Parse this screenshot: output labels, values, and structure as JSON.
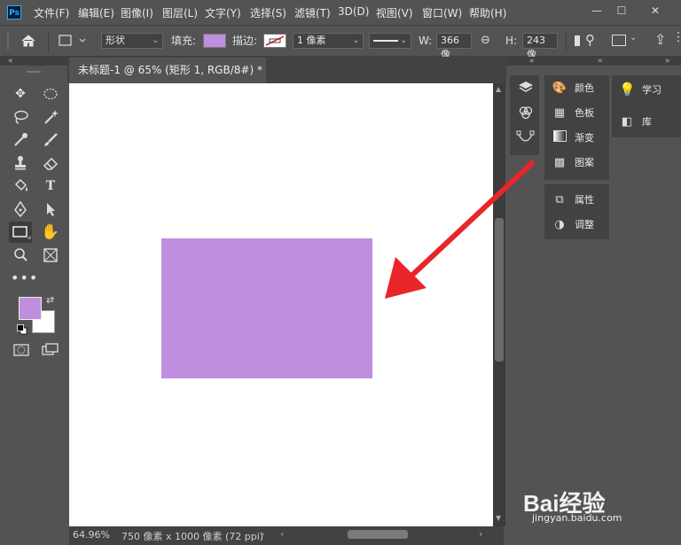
{
  "app": {
    "logo_text": "Ps"
  },
  "menu": [
    {
      "label": "文件(F)"
    },
    {
      "label": "编辑(E)"
    },
    {
      "label": "图像(I)"
    },
    {
      "label": "图层(L)"
    },
    {
      "label": "文字(Y)"
    },
    {
      "label": "选择(S)"
    },
    {
      "label": "滤镜(T)"
    },
    {
      "label": "3D(D)"
    },
    {
      "label": "视图(V)"
    },
    {
      "label": "窗口(W)"
    },
    {
      "label": "帮助(H)"
    }
  ],
  "window_controls": {
    "minimize": "—",
    "maximize": "☐",
    "close": "✕"
  },
  "options": {
    "mode_value": "形状",
    "fill_label": "填充:",
    "fill_color": "#bf8ede",
    "stroke_label": "描边:",
    "stroke_width": "1 像素",
    "w_label": "W:",
    "w_value": "366 像",
    "h_label": "H:",
    "h_value": "243 像"
  },
  "document": {
    "tab_title": "未标题-1 @ 65% (矩形 1, RGB/8#) *",
    "close_glyph": "×",
    "shape_color": "#bf8ede"
  },
  "status": {
    "zoom": "64.96%",
    "info": "750 像素 x 1000 像素 (72 ppi)"
  },
  "panels": {
    "group1": [
      {
        "label": "颜色",
        "icon": "palette-icon"
      },
      {
        "label": "色板",
        "icon": "swatches-icon"
      },
      {
        "label": "渐变",
        "icon": "gradient-icon"
      },
      {
        "label": "图案",
        "icon": "pattern-icon"
      }
    ],
    "group2": [
      {
        "label": "属性",
        "icon": "properties-icon"
      },
      {
        "label": "调整",
        "icon": "adjustments-icon"
      }
    ],
    "right": [
      {
        "label": "学习",
        "icon": "lightbulb-icon"
      },
      {
        "label": "库",
        "icon": "library-icon"
      }
    ]
  },
  "colors": {
    "foreground": "#bf8ede",
    "background": "#ffffff",
    "annotation_arrow": "#e8262a"
  },
  "watermark": {
    "logo": "Bai经验",
    "sub": "jingyan.baidu.com"
  }
}
